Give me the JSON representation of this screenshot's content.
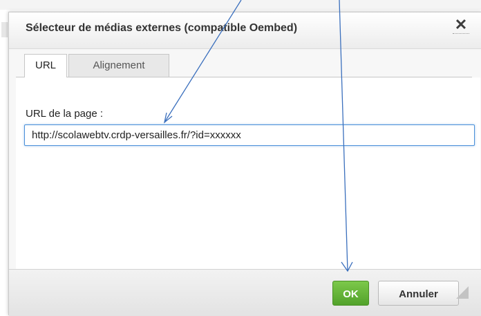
{
  "dialog": {
    "title": "Sélecteur de médias externes (compatible Oembed)",
    "close_glyph": "✕",
    "tabs": [
      {
        "label": "URL",
        "active": true
      },
      {
        "label": "Alignement",
        "active": false
      }
    ],
    "url_field": {
      "label": "URL de la page :",
      "value": "http://scolawebtv.crdp-versailles.fr/?id=xxxxxx"
    },
    "buttons": {
      "ok": "OK",
      "cancel": "Annuler"
    }
  },
  "colors": {
    "annotation_arrow": "#3a6fbd",
    "ok_button": "#62b336",
    "input_focus": "#4a90d9"
  },
  "icons": {
    "close": "close-icon",
    "resize": "resize-grip-icon"
  }
}
